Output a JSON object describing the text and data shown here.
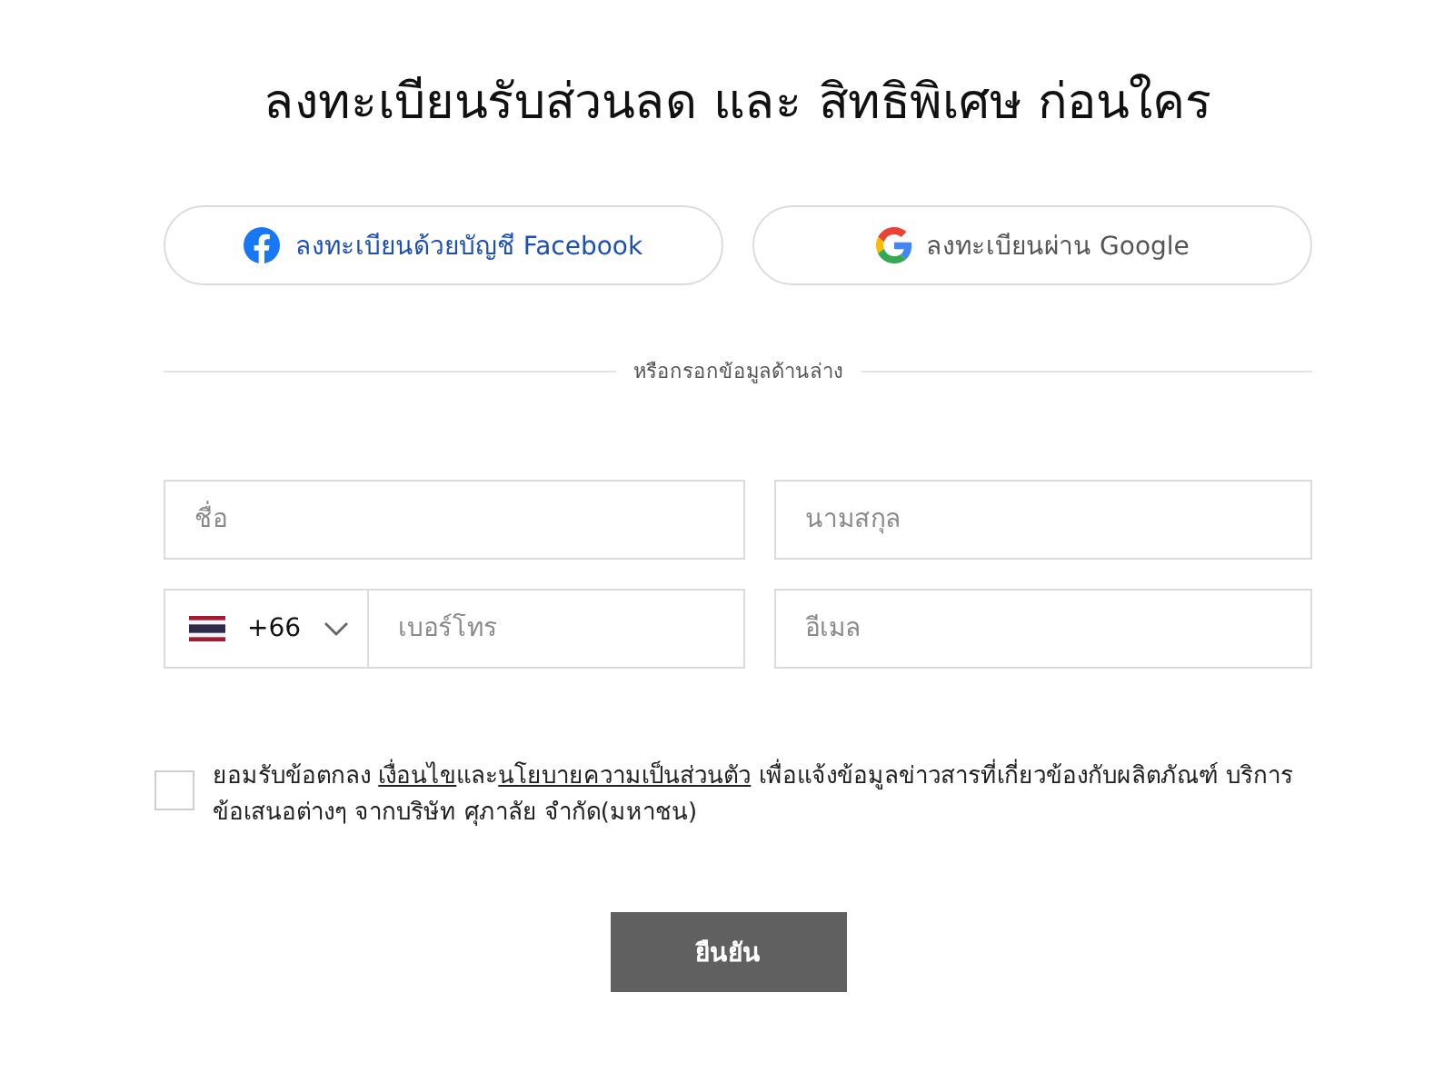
{
  "title": "ลงทะเบียนรับส่วนลด และ สิทธิพิเศษ ก่อนใคร",
  "social_buttons": [
    {
      "kind": "facebook",
      "label": "ลงทะเบียนด้วยบัญชี Facebook"
    },
    {
      "kind": "google",
      "label": "ลงทะเบียนผ่าน Google"
    }
  ],
  "divider": {
    "label": "หรือกรอกข้อมูลด้านล่าง"
  },
  "fields": [
    {
      "kind": "text",
      "placeholder": "ชื่อ"
    },
    {
      "kind": "text",
      "placeholder": "นามสกุล"
    },
    {
      "kind": "phone",
      "country_code": "+66",
      "placeholder": "เบอร์โทร"
    },
    {
      "kind": "text",
      "placeholder": "อีเมล"
    }
  ],
  "consent": {
    "checked": false,
    "parts": [
      {
        "kind": "text",
        "text": "ยอมรับข้อตกลง "
      },
      {
        "kind": "link",
        "text": "เงื่อนไข"
      },
      {
        "kind": "text",
        "text": "และ"
      },
      {
        "kind": "link",
        "text": "นโยบายความเป็นส่วนตัว"
      },
      {
        "kind": "text",
        "text": " เพื่อแจ้งข้อมูลข่าวสารที่เกี่ยวข้องกับผลิตภัณฑ์ บริการ ข้อเสนอต่างๆ จากบริษัท ศุภาลัย จำกัด(มหาชน)"
      }
    ]
  },
  "submit": {
    "label": "ยืนยัน"
  }
}
